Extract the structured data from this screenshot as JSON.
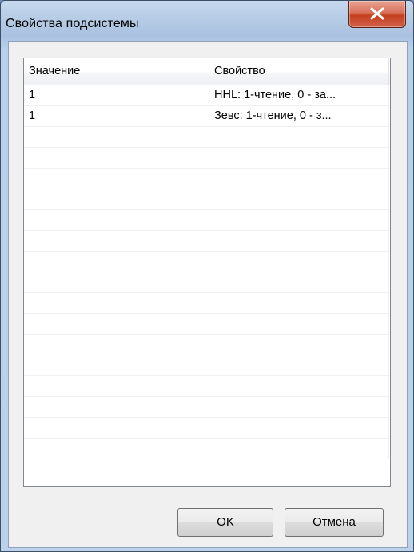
{
  "window": {
    "title": "Свойства подсистемы"
  },
  "table": {
    "columns": [
      "Значение",
      "Свойство"
    ],
    "rows": [
      {
        "value": "1",
        "property": "HHL: 1-чтение, 0 - за..."
      },
      {
        "value": "1",
        "property": "Зевс: 1-чтение, 0 - з..."
      },
      {
        "value": "",
        "property": ""
      },
      {
        "value": "",
        "property": ""
      },
      {
        "value": "",
        "property": ""
      },
      {
        "value": "",
        "property": ""
      },
      {
        "value": "",
        "property": ""
      },
      {
        "value": "",
        "property": ""
      },
      {
        "value": "",
        "property": ""
      },
      {
        "value": "",
        "property": ""
      },
      {
        "value": "",
        "property": ""
      },
      {
        "value": "",
        "property": ""
      },
      {
        "value": "",
        "property": ""
      },
      {
        "value": "",
        "property": ""
      },
      {
        "value": "",
        "property": ""
      },
      {
        "value": "",
        "property": ""
      },
      {
        "value": "",
        "property": ""
      },
      {
        "value": "",
        "property": ""
      }
    ]
  },
  "buttons": {
    "ok_label": "OK",
    "cancel_label": "Отмена"
  },
  "icons": {
    "close": "close-icon"
  },
  "colors": {
    "close_button": "#c3401f",
    "frame": "#b9d0ea"
  }
}
